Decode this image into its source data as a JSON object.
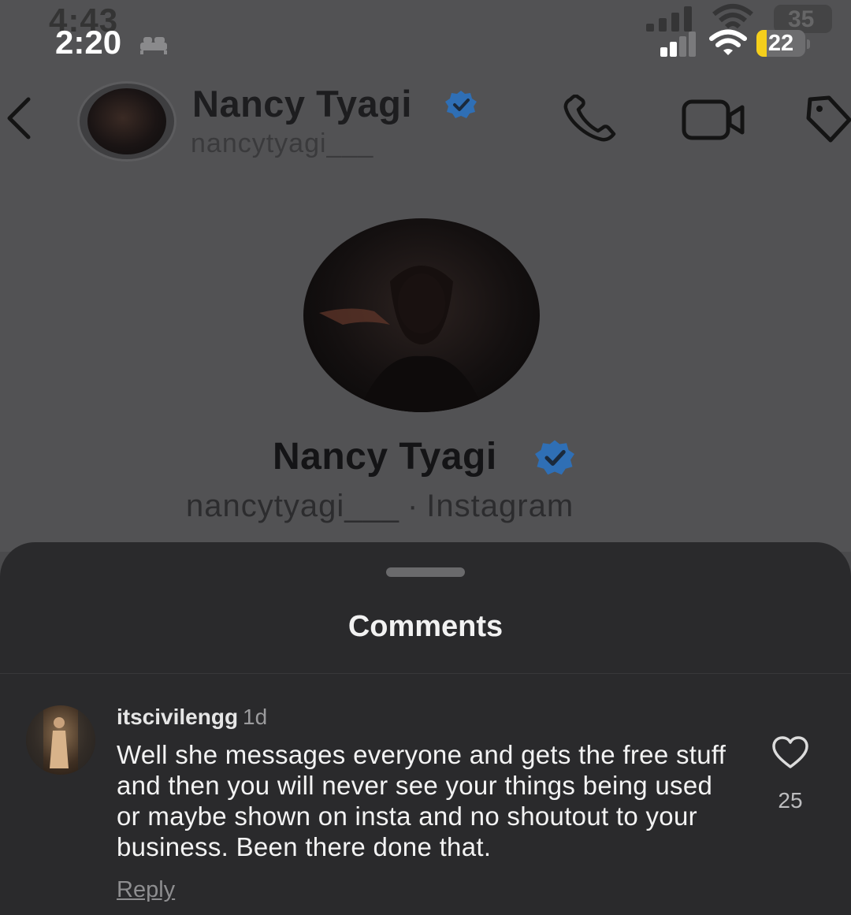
{
  "status_bar": {
    "ghost_time": "4:43",
    "time": "2:20",
    "ghost_battery": "35",
    "battery": "22",
    "colors": {
      "battery_fill": "#f5cf1b"
    },
    "icons": [
      "bed-icon",
      "signal-icon",
      "wifi-icon",
      "battery-icon"
    ]
  },
  "header": {
    "name": "Nancy Tyagi",
    "handle": "nancytyagi___",
    "icons": [
      "back-icon",
      "verified-icon",
      "phone-icon",
      "video-icon",
      "tag-icon"
    ]
  },
  "profile": {
    "name": "Nancy Tyagi",
    "handle": "nancytyagi___",
    "platform": "Instagram",
    "colors": {
      "verified": "#2f6fb5"
    }
  },
  "comments_sheet": {
    "title": "Comments",
    "comment": {
      "username": "itscivilengg",
      "time": "1d",
      "text": "Well she messages everyone and gets the free stuff and then you will never see your things being used or maybe shown on insta and no shoutout to your business. Been there done that.",
      "reply_label": "Reply",
      "like_count": "25",
      "icons": [
        "heart-icon"
      ]
    }
  }
}
